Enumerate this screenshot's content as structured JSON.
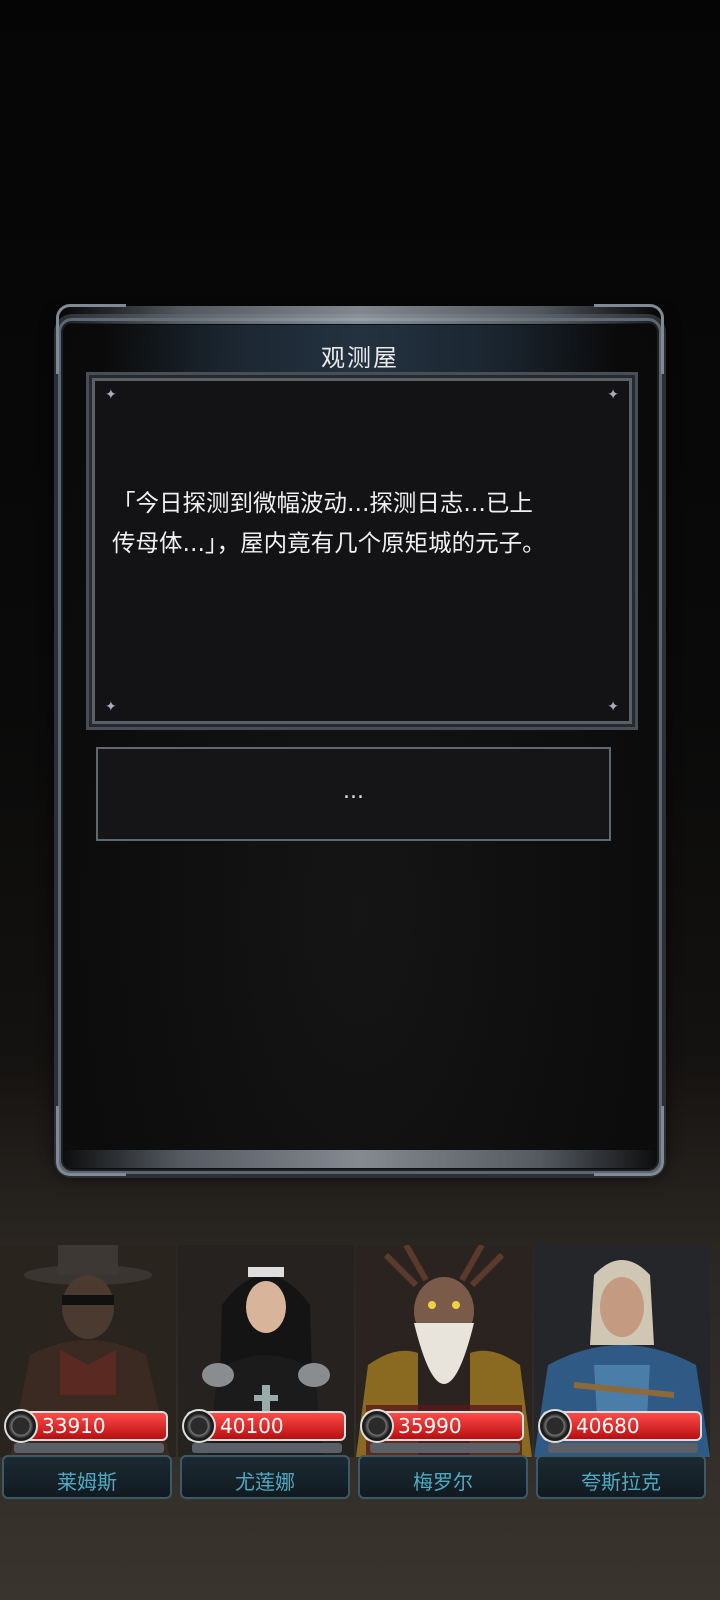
{
  "dialog": {
    "title": "观测屋",
    "story_line1": "「今日探测到微幅波动...探测日志...已上",
    "story_line2": "传母体...」，屋内竟有几个原矩城的元子。",
    "choice": "..."
  },
  "party": [
    {
      "name": "莱姆斯",
      "hp": "33910"
    },
    {
      "name": "尤莲娜",
      "hp": "40100"
    },
    {
      "name": "梅罗尔",
      "hp": "35990"
    },
    {
      "name": "夸斯拉克",
      "hp": "40680"
    }
  ],
  "colors": {
    "hp_bar": "#d0161a",
    "name_text": "#4fa9c2",
    "panel_border": "#5d6670"
  }
}
